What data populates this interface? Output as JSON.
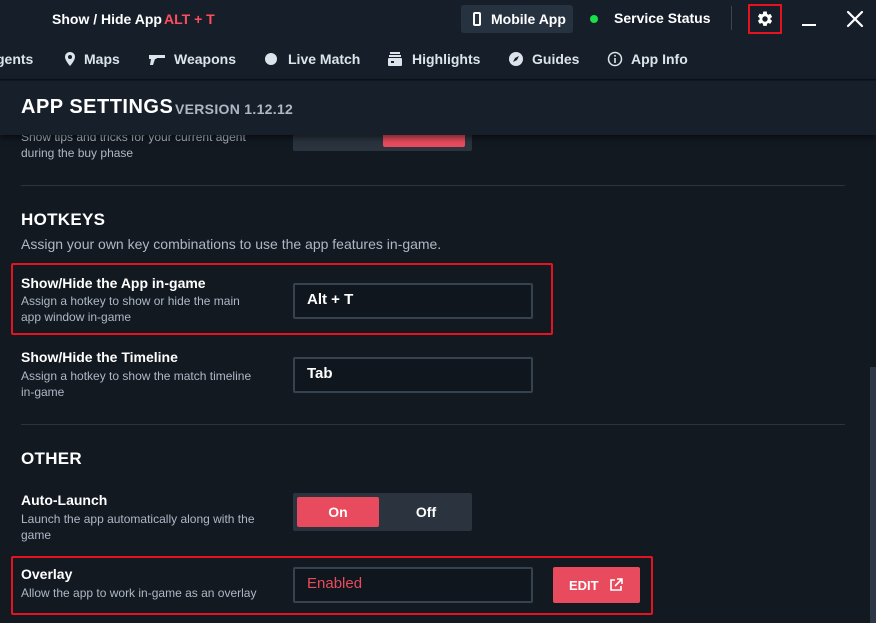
{
  "titlebar": {
    "label": "Show / Hide App",
    "hotkey": "ALT + T",
    "mobile_app": "Mobile App",
    "service_status": "Service Status",
    "status_color": "#18e046"
  },
  "nav": {
    "items": [
      {
        "label": "gents",
        "icon": ""
      },
      {
        "label": "Maps",
        "icon": "map-pin-icon"
      },
      {
        "label": "Weapons",
        "icon": "gun-icon"
      },
      {
        "label": "Live Match",
        "icon": "circle-icon"
      },
      {
        "label": "Highlights",
        "icon": "film-stack-icon"
      },
      {
        "label": "Guides",
        "icon": "compass-icon"
      },
      {
        "label": "App Info",
        "icon": "info-icon"
      }
    ]
  },
  "header": {
    "title": "APP SETTINGS",
    "version": "VERSION 1.12.12"
  },
  "settings": {
    "tips_desc": "Show tips and tricks for your current agent during the buy phase",
    "hotkeys": {
      "title": "HOTKEYS",
      "subtitle": "Assign your own key combinations to use the app features in-game.",
      "show_hide_app": {
        "label": "Show/Hide the App in-game",
        "desc": "Assign a hotkey to show or hide the main app window in-game",
        "value": "Alt + T"
      },
      "show_hide_timeline": {
        "label": "Show/Hide the Timeline",
        "desc": "Assign a hotkey to show the match timeline in-game",
        "value": "Tab"
      }
    },
    "other": {
      "title": "OTHER",
      "auto_launch": {
        "label": "Auto-Launch",
        "desc": "Launch the app automatically along with the game",
        "on": "On",
        "off": "Off",
        "selected": "On"
      },
      "overlay": {
        "label": "Overlay",
        "desc": "Allow the app to work in-game as an overlay",
        "status": "Enabled",
        "edit": "EDIT"
      }
    }
  },
  "colors": {
    "accent": "#e84b5d",
    "highlight": "#e5121f",
    "background": "#121921"
  }
}
